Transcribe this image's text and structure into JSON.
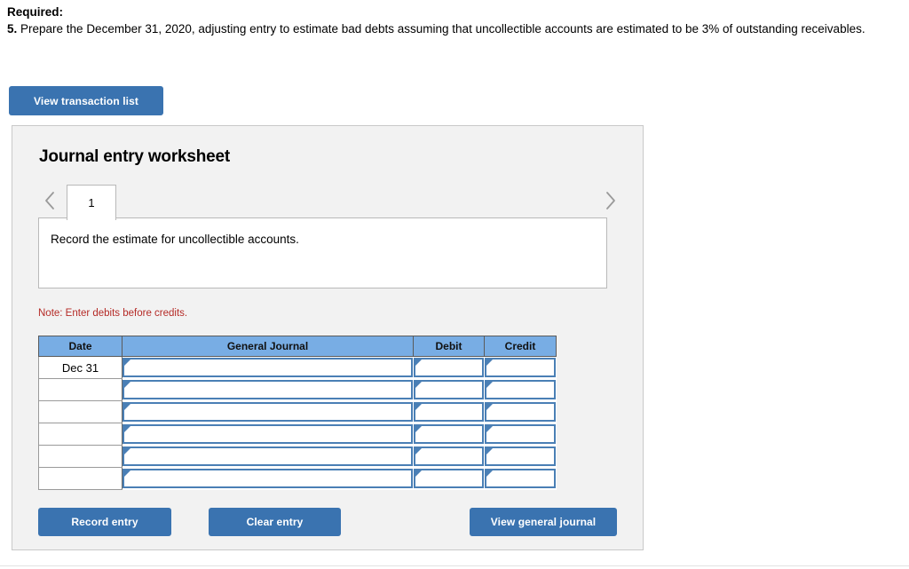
{
  "prompt": {
    "required_label": "Required:",
    "question_number": "5.",
    "question_text": " Prepare the December 31, 2020, adjusting entry to estimate bad debts assuming that uncollectible accounts are estimated to be 3% of outstanding receivables."
  },
  "buttons": {
    "view_transaction_list": "View transaction list",
    "record_entry": "Record entry",
    "clear_entry": "Clear entry",
    "view_general_journal": "View general journal"
  },
  "worksheet": {
    "title": "Journal entry worksheet",
    "nav_prev_icon": "chevron-left-icon",
    "nav_next_icon": "chevron-right-icon",
    "tabs": [
      {
        "label": "1",
        "active": true
      }
    ],
    "description": "Record the estimate for uncollectible accounts.",
    "note": "Note: Enter debits before credits."
  },
  "journal_table": {
    "columns": [
      "Date",
      "General Journal",
      "Debit",
      "Credit"
    ],
    "rows": [
      {
        "date": "Dec 31",
        "general_journal": "",
        "debit": "",
        "credit": ""
      },
      {
        "date": "",
        "general_journal": "",
        "debit": "",
        "credit": ""
      },
      {
        "date": "",
        "general_journal": "",
        "debit": "",
        "credit": ""
      },
      {
        "date": "",
        "general_journal": "",
        "debit": "",
        "credit": ""
      },
      {
        "date": "",
        "general_journal": "",
        "debit": "",
        "credit": ""
      },
      {
        "date": "",
        "general_journal": "",
        "debit": "",
        "credit": ""
      }
    ]
  },
  "colors": {
    "button_blue": "#3a73b0",
    "table_header_blue": "#78ade4",
    "input_border_blue": "#4a7fb5",
    "note_red": "#b52b27",
    "panel_gray": "#f2f2f2"
  }
}
